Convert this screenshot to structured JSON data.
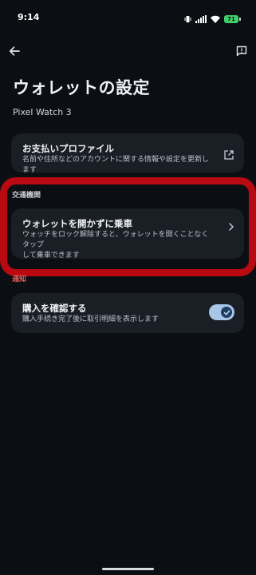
{
  "status_bar": {
    "time": "9:14",
    "battery": "71",
    "icons": [
      "vibrate-icon",
      "signal-icon",
      "wifi-icon",
      "battery-icon"
    ]
  },
  "app_bar": {
    "back_icon": "arrow-back-icon",
    "feedback_icon": "feedback-icon"
  },
  "header": {
    "title": "ウォレットの設定",
    "device": "Pixel Watch 3"
  },
  "payment_profile": {
    "title": "お支払いプロファイル",
    "subtitle": "名前や住所などのアカウントに関する情報や設定を更新します",
    "icon": "open-in-new-icon"
  },
  "transit": {
    "section_label": "交通機関",
    "title": "ウォレットを開かずに乗車",
    "subtitle_line1": "ウォッチをロック解除すると、ウォレットを開くことなくタップ",
    "subtitle_line2": "して乗車できます",
    "icon": "chevron-right-icon"
  },
  "notifications": {
    "section_label": "通知",
    "title": "購入を確認する",
    "subtitle": "購入手続き完了後に取引明細を表示します",
    "toggle_on": true
  },
  "colors": {
    "background": "#0b0e12",
    "card": "#1a1e25",
    "highlight": "#b80a10",
    "toggle_track": "#a8c6e6",
    "toggle_knob": "#1f3f66",
    "battery": "#3fd06a"
  }
}
